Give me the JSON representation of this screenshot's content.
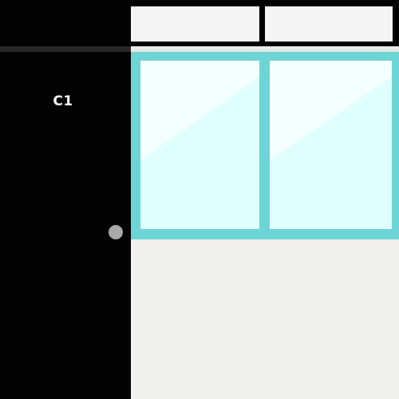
{
  "door": {
    "label": "C1",
    "color": "#020202",
    "handle_color": "#a9a9a9"
  },
  "window": {
    "frame_color": "#6dd5d5",
    "glass_color": "#e0ffff"
  },
  "wall": {
    "color": "#f1f0ec"
  }
}
